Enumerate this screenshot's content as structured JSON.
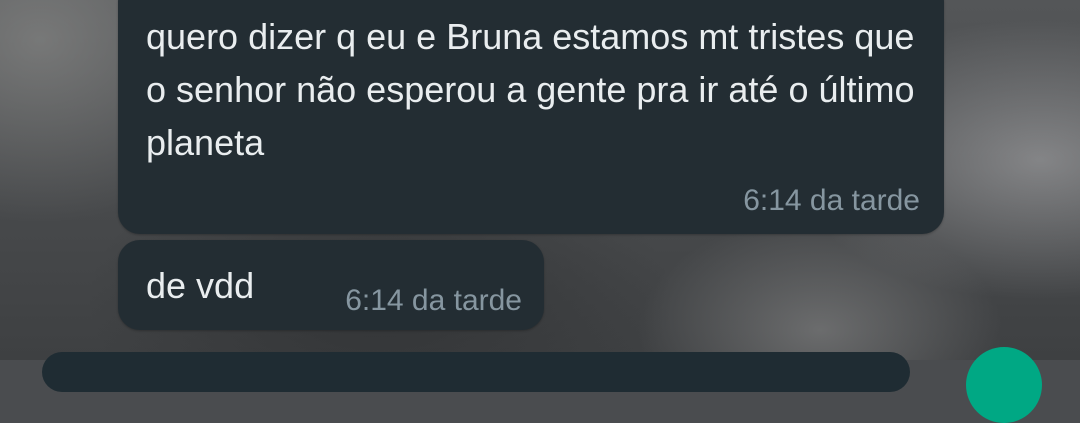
{
  "messages": [
    {
      "text": "quero dizer q eu e Bruna estamos mt tristes que o senhor não esperou a gente pra ir até o último planeta",
      "time": "6:14 da tarde"
    },
    {
      "text": "de vdd",
      "time": "6:14 da tarde"
    }
  ],
  "colors": {
    "bubble": "#232d33",
    "text": "#e9edef",
    "timestamp": "#8696a0",
    "accent": "#00a884"
  },
  "icons": {
    "send": "send-button"
  }
}
